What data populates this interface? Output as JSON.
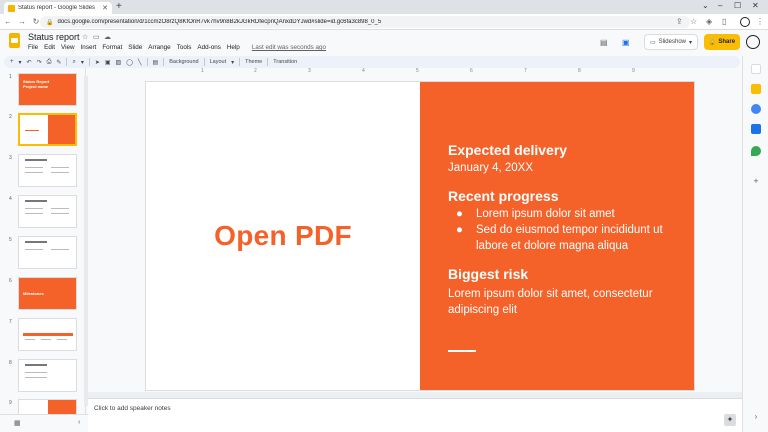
{
  "browser": {
    "tab_title": "Status report - Google Slides",
    "url": "docs.google.com/presentation/d/1ccmzO8rzQ8KfOnR7vk7hv9n8B2kJGkRDfecpnQAnxdDYJwd#slide=id.gc6fa3c898_0_5"
  },
  "app": {
    "doc_title": "Status report",
    "menu": [
      "File",
      "Edit",
      "View",
      "Insert",
      "Format",
      "Slide",
      "Arrange",
      "Tools",
      "Add-ons",
      "Help"
    ],
    "last_edit": "Last edit was seconds ago",
    "slideshow_label": "Slideshow",
    "share_label": "Share"
  },
  "toolbar": {
    "background": "Background",
    "layout": "Layout",
    "theme": "Theme",
    "transition": "Transition"
  },
  "ruler": [
    "1",
    "2",
    "3",
    "4",
    "5",
    "6",
    "7",
    "8",
    "9"
  ],
  "filmstrip": {
    "numbers": [
      "1",
      "2",
      "3",
      "4",
      "5",
      "6",
      "7",
      "8",
      "9"
    ],
    "slide1_title": "Status Report\nProject name",
    "slide6_title": "Milestones"
  },
  "slide": {
    "open_pdf": "Open PDF",
    "expected_heading": "Expected delivery",
    "expected_date": "January 4, 20XX",
    "progress_heading": "Recent progress",
    "bullets": [
      "Lorem ipsum dolor sit amet",
      "Sed do eiusmod tempor incididunt ut labore et dolore magna aliqua"
    ],
    "risk_heading": "Biggest risk",
    "risk_text": "Lorem ipsum dolor sit amet, consectetur adipiscing elit"
  },
  "notes": {
    "placeholder": "Click to add speaker notes"
  },
  "colors": {
    "accent": "#f4622a",
    "share": "#fbbc04"
  }
}
